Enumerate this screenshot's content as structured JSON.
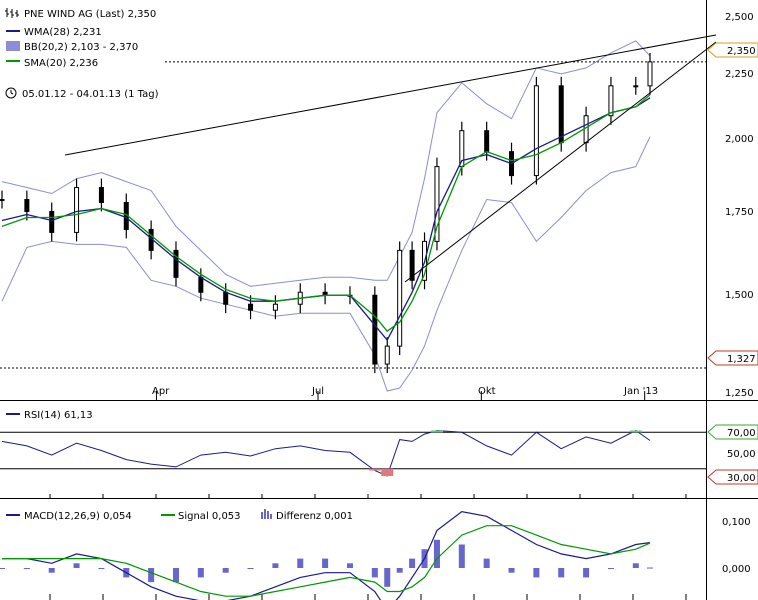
{
  "header": {
    "title": "PNE WIND AG (Last) 2,350",
    "wma": "WMA(28) 2,231",
    "bb": "BB(20,2) 2,103 - 2,370",
    "sma": "SMA(20) 2,236",
    "period": "05.01.12 - 04.01.13 (1 Tag)"
  },
  "colors": {
    "price": "#000000",
    "wma": "#1a1a8c",
    "sma": "#009900",
    "bb": "#8c8cd9",
    "rsi": "#1a1a8c",
    "macd": "#1a1a8c",
    "signal": "#009900",
    "hist": "#6666cc",
    "rsiHigh": "#66cc66",
    "rsiLow": "#e07a7a",
    "trendline": "#000000"
  },
  "rsi_panel": {
    "label": "RSI(14) 61,13",
    "levels": [
      "70,00",
      "50,00",
      "30,00"
    ]
  },
  "macd_panel": {
    "macd_label": "MACD(12,26,9) 0,054",
    "signal_label": "Signal 0,053",
    "hist_label": "Differenz 0,001",
    "ticks": [
      "0,100",
      "0,000"
    ]
  },
  "chart_data": {
    "type": "line",
    "title": "PNE WIND AG (Last) 2,350",
    "x_tick_labels": [
      "Apr",
      "Jul",
      "Okt",
      "Jan '13"
    ],
    "x_tick_dates": [
      "2012-04-01",
      "2012-07-01",
      "2012-10-01",
      "2013-01-01"
    ],
    "y_tick_labels": [
      "2,500",
      "2,250",
      "2,000",
      "1,750",
      "1,500",
      "1,250"
    ],
    "ylim": [
      1.25,
      2.5
    ],
    "markers": {
      "last": "2,350",
      "low": "1,327"
    },
    "dates": [
      "2012-01-05",
      "2012-01-19",
      "2012-02-02",
      "2012-02-16",
      "2012-03-01",
      "2012-03-15",
      "2012-03-29",
      "2012-04-12",
      "2012-04-26",
      "2012-05-10",
      "2012-05-24",
      "2012-06-07",
      "2012-06-21",
      "2012-07-05",
      "2012-07-19",
      "2012-08-02",
      "2012-08-09",
      "2012-08-16",
      "2012-08-23",
      "2012-08-30",
      "2012-09-06",
      "2012-09-20",
      "2012-10-04",
      "2012-10-18",
      "2012-11-01",
      "2012-11-15",
      "2012-11-29",
      "2012-12-13",
      "2012-12-27",
      "2013-01-04"
    ],
    "series": [
      {
        "name": "PNE WIND AG (Last)",
        "values": [
          1.89,
          1.85,
          1.78,
          1.93,
          1.88,
          1.79,
          1.72,
          1.63,
          1.58,
          1.54,
          1.52,
          1.54,
          1.58,
          1.57,
          1.57,
          1.34,
          1.4,
          1.72,
          1.62,
          1.75,
          2.0,
          2.12,
          2.05,
          1.97,
          2.27,
          2.08,
          2.17,
          2.27,
          2.27,
          2.35
        ]
      },
      {
        "name": "WMA(28)",
        "values": [
          1.82,
          1.84,
          1.82,
          1.85,
          1.86,
          1.83,
          1.76,
          1.69,
          1.63,
          1.58,
          1.55,
          1.55,
          1.56,
          1.57,
          1.57,
          1.47,
          1.42,
          1.5,
          1.58,
          1.68,
          1.85,
          2.02,
          2.04,
          2.01,
          2.06,
          2.1,
          2.14,
          2.18,
          2.2,
          2.23
        ]
      },
      {
        "name": "SMA(20)",
        "values": [
          1.8,
          1.83,
          1.83,
          1.84,
          1.86,
          1.84,
          1.77,
          1.7,
          1.64,
          1.59,
          1.56,
          1.55,
          1.56,
          1.57,
          1.57,
          1.5,
          1.45,
          1.48,
          1.55,
          1.64,
          1.8,
          2.0,
          2.05,
          2.02,
          2.04,
          2.08,
          2.13,
          2.18,
          2.2,
          2.24
        ]
      },
      {
        "name": "BB upper",
        "values": [
          1.95,
          1.93,
          1.91,
          1.96,
          1.98,
          1.95,
          1.92,
          1.8,
          1.72,
          1.64,
          1.6,
          1.61,
          1.62,
          1.63,
          1.63,
          1.62,
          1.62,
          1.7,
          1.78,
          1.96,
          2.18,
          2.28,
          2.21,
          2.16,
          2.33,
          2.31,
          2.33,
          2.38,
          2.42,
          2.37
        ]
      },
      {
        "name": "BB lower",
        "values": [
          1.55,
          1.73,
          1.75,
          1.74,
          1.74,
          1.73,
          1.62,
          1.6,
          1.56,
          1.54,
          1.52,
          1.5,
          1.51,
          1.51,
          1.51,
          1.37,
          1.25,
          1.26,
          1.32,
          1.4,
          1.52,
          1.72,
          1.89,
          1.88,
          1.75,
          1.83,
          1.92,
          1.98,
          2.0,
          2.1
        ]
      }
    ],
    "rsi": {
      "name": "RSI(14)",
      "values": [
        60,
        55,
        45,
        58,
        50,
        40,
        35,
        32,
        45,
        48,
        44,
        52,
        55,
        50,
        48,
        28,
        22,
        62,
        60,
        68,
        72,
        70,
        55,
        45,
        70,
        52,
        65,
        58,
        72,
        61
      ]
    },
    "macd": {
      "macd": [
        0.02,
        0.02,
        0.01,
        0.03,
        0.02,
        -0.01,
        -0.04,
        -0.06,
        -0.07,
        -0.07,
        -0.06,
        -0.04,
        -0.02,
        -0.01,
        -0.01,
        -0.05,
        -0.09,
        -0.06,
        -0.02,
        0.02,
        0.08,
        0.12,
        0.11,
        0.08,
        0.05,
        0.03,
        0.02,
        0.03,
        0.05,
        0.054
      ],
      "signal": [
        0.02,
        0.02,
        0.02,
        0.02,
        0.02,
        0.01,
        -0.01,
        -0.03,
        -0.05,
        -0.06,
        -0.06,
        -0.05,
        -0.04,
        -0.03,
        -0.02,
        -0.03,
        -0.05,
        -0.05,
        -0.04,
        -0.02,
        0.02,
        0.07,
        0.09,
        0.09,
        0.07,
        0.05,
        0.04,
        0.03,
        0.04,
        0.053
      ]
    }
  }
}
